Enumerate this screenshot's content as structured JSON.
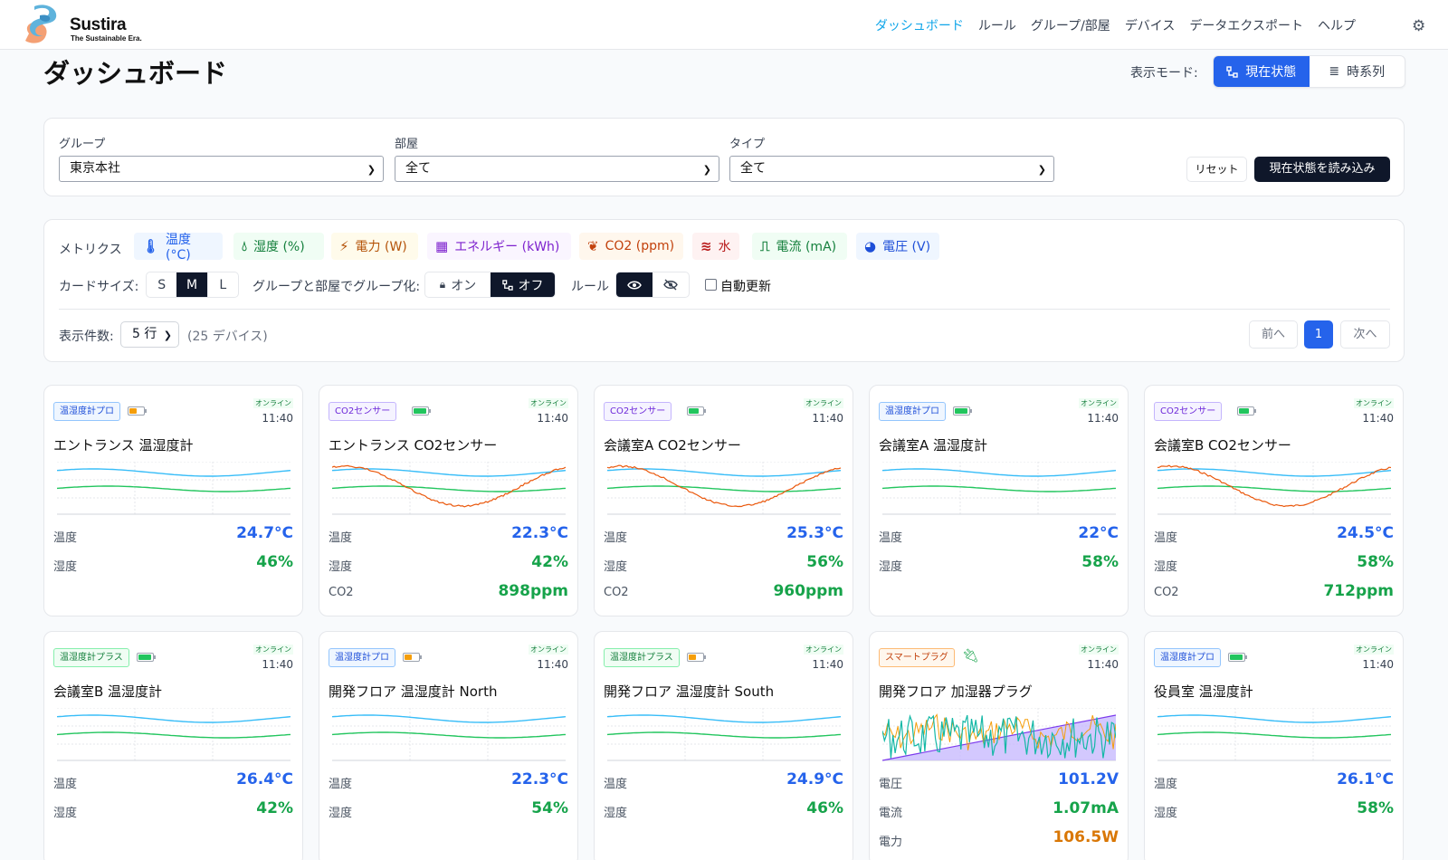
{
  "header": {
    "brand": "Sustira",
    "tagline": "The Sustainable Era.",
    "nav": [
      {
        "label": "ダッシュボード",
        "active": true
      },
      {
        "label": "ルール",
        "active": false
      },
      {
        "label": "グループ/部屋",
        "active": false
      },
      {
        "label": "デバイス",
        "active": false
      },
      {
        "label": "データエクスポート",
        "active": false
      },
      {
        "label": "ヘルプ",
        "active": false
      }
    ],
    "settings_icon": "gear-icon"
  },
  "page": {
    "title": "ダッシュボード",
    "mode_label": "表示モード:",
    "mode_current": "現在状態",
    "mode_timeseries": "時系列"
  },
  "filters": {
    "group_label": "グループ",
    "group_value": "東京本社",
    "room_label": "部屋",
    "room_value": "全て",
    "type_label": "タイプ",
    "type_value": "全て",
    "reset": "リセット",
    "load": "現在状態を読み込み"
  },
  "metrics": {
    "label": "メトリクス",
    "chips": [
      {
        "label": "温度 (°C)",
        "icon": "thermometer-icon",
        "color": "#2563eb",
        "bg": "#eff6ff"
      },
      {
        "label": "湿度 (%)",
        "icon": "droplet-icon",
        "color": "#15803d",
        "bg": "#f0fdf4"
      },
      {
        "label": "電力 (W)",
        "icon": "bolt-icon",
        "color": "#b45309",
        "bg": "#fffbeb"
      },
      {
        "label": "エネルギー (kWh)",
        "icon": "calculator-icon",
        "color": "#7e22ce",
        "bg": "#faf5ff"
      },
      {
        "label": "CO2 (ppm)",
        "icon": "leaf-icon",
        "color": "#c2410c",
        "bg": "#fff7ed"
      },
      {
        "label": "水",
        "icon": "water-waves-icon",
        "color": "#b91c1c",
        "bg": "#fef2f2"
      },
      {
        "label": "電流 (mA)",
        "icon": "pulse-icon",
        "color": "#15803d",
        "bg": "#f0fdf4"
      },
      {
        "label": "電圧 (V)",
        "icon": "gauge-icon",
        "color": "#1d4ed8",
        "bg": "#eff6ff"
      }
    ],
    "card_size_label": "カードサイズ:",
    "sizes": [
      "S",
      "M",
      "L"
    ],
    "size_selected": "M",
    "grouping_label": "グループと部屋でグループ化:",
    "grouping_on": "オン",
    "grouping_off": "オフ",
    "grouping_selected": "オフ",
    "rule_label": "ルール",
    "auto_refresh": "自動更新",
    "auto_refresh_checked": false,
    "rows_label": "表示件数:",
    "rows_value": "5 行",
    "device_count": "(25 デバイス)",
    "prev": "前へ",
    "page": "1",
    "next": "次へ"
  },
  "cards": [
    {
      "type": "温湿度計プロ",
      "tag_color": "blue",
      "battery": 0.5,
      "battery_color": "#f59e0b",
      "status": "オンライン",
      "time": "11:40",
      "name": "エントランス 温湿度計",
      "chart": "th",
      "metrics": [
        {
          "label": "温度",
          "value": "24.7°C",
          "color": "blue"
        },
        {
          "label": "湿度",
          "value": "46%",
          "color": "green"
        }
      ]
    },
    {
      "type": "CO2センサー",
      "tag_color": "purple",
      "battery": 0.9,
      "battery_color": "#22c55e",
      "status": "オンライン",
      "time": "11:40",
      "name": "エントランス CO2センサー",
      "chart": "co2",
      "metrics": [
        {
          "label": "温度",
          "value": "22.3°C",
          "color": "blue"
        },
        {
          "label": "湿度",
          "value": "42%",
          "color": "green"
        },
        {
          "label": "CO2",
          "value": "898ppm",
          "color": "green"
        }
      ]
    },
    {
      "type": "CO2センサー",
      "tag_color": "purple",
      "battery": 0.7,
      "battery_color": "#22c55e",
      "status": "オンライン",
      "time": "11:40",
      "name": "会議室A CO2センサー",
      "chart": "co2",
      "metrics": [
        {
          "label": "温度",
          "value": "25.3°C",
          "color": "blue"
        },
        {
          "label": "湿度",
          "value": "56%",
          "color": "green"
        },
        {
          "label": "CO2",
          "value": "960ppm",
          "color": "green"
        }
      ]
    },
    {
      "type": "温湿度計プロ",
      "tag_color": "blue",
      "battery": 0.9,
      "battery_color": "#22c55e",
      "status": "オンライン",
      "time": "11:40",
      "name": "会議室A 温湿度計",
      "chart": "th",
      "metrics": [
        {
          "label": "温度",
          "value": "22°C",
          "color": "blue"
        },
        {
          "label": "湿度",
          "value": "58%",
          "color": "green"
        }
      ]
    },
    {
      "type": "CO2センサー",
      "tag_color": "purple",
      "battery": 0.7,
      "battery_color": "#22c55e",
      "status": "オンライン",
      "time": "11:40",
      "name": "会議室B CO2センサー",
      "chart": "co2",
      "metrics": [
        {
          "label": "温度",
          "value": "24.5°C",
          "color": "blue"
        },
        {
          "label": "湿度",
          "value": "58%",
          "color": "green"
        },
        {
          "label": "CO2",
          "value": "712ppm",
          "color": "green"
        }
      ]
    },
    {
      "type": "温湿度計プラス",
      "tag_color": "green",
      "battery": 0.9,
      "battery_color": "#22c55e",
      "status": "オンライン",
      "time": "11:40",
      "name": "会議室B 温湿度計",
      "chart": "th",
      "metrics": [
        {
          "label": "温度",
          "value": "26.4°C",
          "color": "blue"
        },
        {
          "label": "湿度",
          "value": "42%",
          "color": "green"
        }
      ]
    },
    {
      "type": "温湿度計プロ",
      "tag_color": "blue",
      "battery": 0.5,
      "battery_color": "#f59e0b",
      "status": "オンライン",
      "time": "11:40",
      "name": "開発フロア 温湿度計 North",
      "chart": "th",
      "metrics": [
        {
          "label": "温度",
          "value": "22.3°C",
          "color": "blue"
        },
        {
          "label": "湿度",
          "value": "54%",
          "color": "green"
        }
      ]
    },
    {
      "type": "温湿度計プラス",
      "tag_color": "green",
      "battery": 0.5,
      "battery_color": "#f59e0b",
      "status": "オンライン",
      "time": "11:40",
      "name": "開発フロア 温湿度計 South",
      "chart": "th",
      "metrics": [
        {
          "label": "温度",
          "value": "24.9°C",
          "color": "blue"
        },
        {
          "label": "湿度",
          "value": "46%",
          "color": "green"
        }
      ]
    },
    {
      "type": "スマートプラグ",
      "tag_color": "orange",
      "battery": null,
      "status": "オンライン",
      "time": "11:40",
      "name": "開発フロア 加湿器プラグ",
      "chart": "plug",
      "metrics": [
        {
          "label": "電圧",
          "value": "101.2V",
          "color": "blue"
        },
        {
          "label": "電流",
          "value": "1.07mA",
          "color": "green"
        },
        {
          "label": "電力",
          "value": "106.5W",
          "color": "orange"
        }
      ]
    },
    {
      "type": "温湿度計プロ",
      "tag_color": "blue",
      "battery": 0.9,
      "battery_color": "#22c55e",
      "status": "オンライン",
      "time": "11:40",
      "name": "役員室 温湿度計",
      "chart": "th",
      "metrics": [
        {
          "label": "温度",
          "value": "26.1°C",
          "color": "blue"
        },
        {
          "label": "湿度",
          "value": "58%",
          "color": "green"
        }
      ]
    }
  ]
}
